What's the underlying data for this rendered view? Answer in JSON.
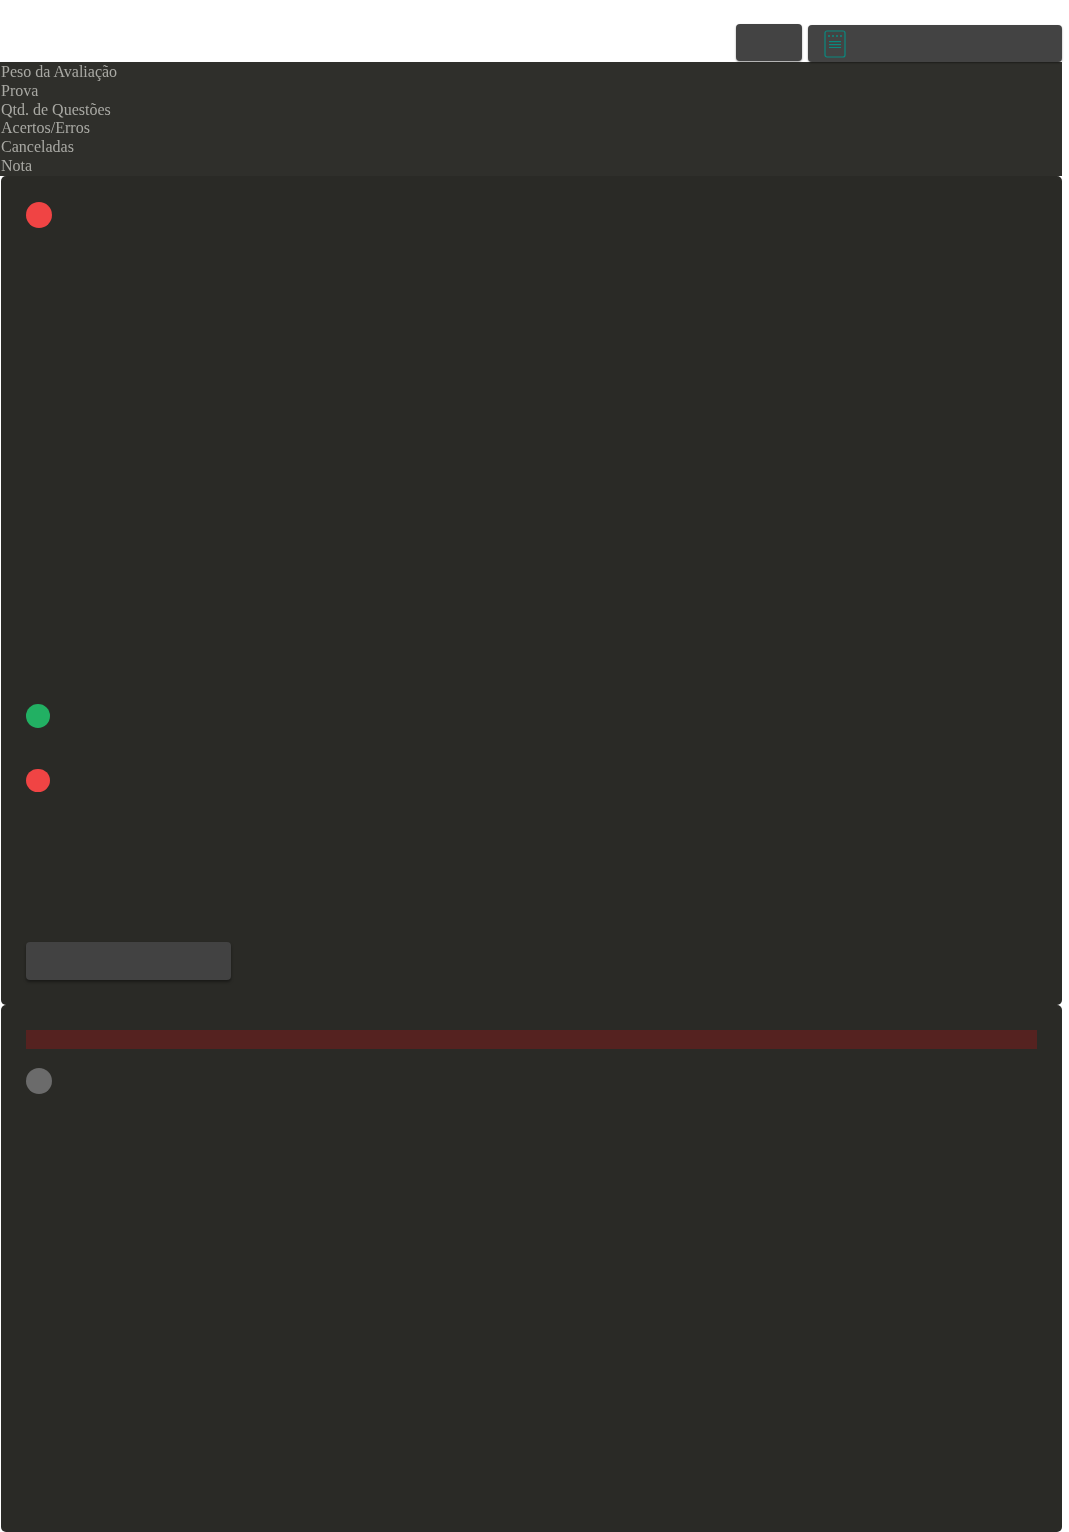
{
  "header_columns": [
    "Peso da Avaliação",
    "Prova",
    "Qtd. de Questões",
    "Acertos/Erros",
    "Canceladas",
    "Nota"
  ],
  "result_card": {
    "markers": [
      {
        "color": "#f04444"
      },
      {
        "color": "#22b063"
      },
      {
        "color": "#f04444"
      }
    ]
  },
  "detail_card": {
    "markers": [
      {
        "color": "#6b6b6b"
      }
    ]
  }
}
